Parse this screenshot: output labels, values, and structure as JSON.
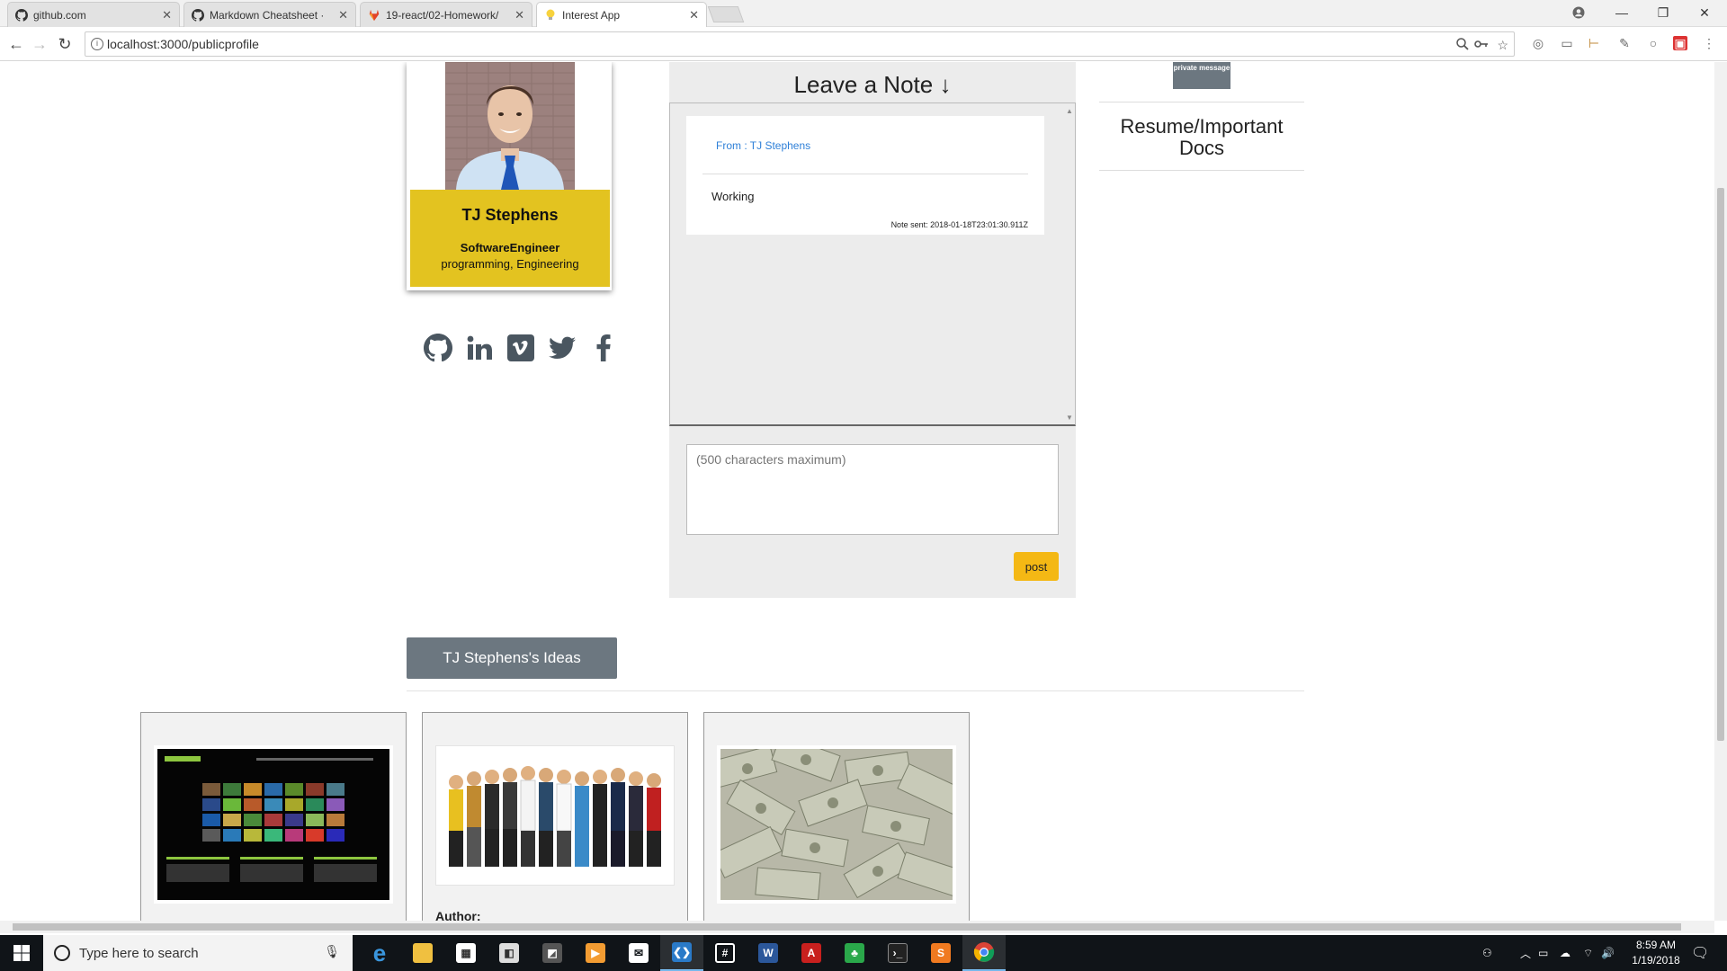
{
  "browser": {
    "tabs": [
      {
        "title": "github.com",
        "icon": "github-icon"
      },
      {
        "title": "Markdown Cheatsheet · ",
        "icon": "github-icon"
      },
      {
        "title": "19-react/02-Homework/",
        "icon": "gitlab-icon"
      },
      {
        "title": "Interest App",
        "icon": "lightbulb-icon"
      }
    ],
    "url": "localhost:3000/publicprofile"
  },
  "profile": {
    "name": "TJ Stephens",
    "title": "SoftwareEngineer",
    "interests": "programming, Engineering"
  },
  "socials": [
    "github-icon",
    "linkedin-icon",
    "vimeo-icon",
    "twitter-icon",
    "facebook-icon"
  ],
  "notes": {
    "heading": "Leave a Note ↓",
    "items": [
      {
        "from": "From : TJ Stephens",
        "text": "Working",
        "date": "Note sent: 2018-01-18T23:01:30.911Z"
      }
    ],
    "input_placeholder": "(500 characters maximum)",
    "post_label": "post"
  },
  "sidebar": {
    "private_message": "private message",
    "resume_heading": "Resume/Important Docs"
  },
  "ideas": {
    "button_label": "TJ Stephens's Ideas",
    "author_label": "Author:",
    "cards": [
      {
        "image": "photocrati-website-screenshot"
      },
      {
        "image": "group-of-professionals-photo"
      },
      {
        "image": "hundred-dollar-bills-photo"
      }
    ]
  },
  "taskbar": {
    "search_placeholder": "Type here to search",
    "time": "8:59 AM",
    "date": "1/19/2018"
  },
  "colors": {
    "card_accent": "#e3c320",
    "post_button": "#f4b814",
    "slate_button": "#6c7780",
    "link_blue": "#2f80d8"
  }
}
